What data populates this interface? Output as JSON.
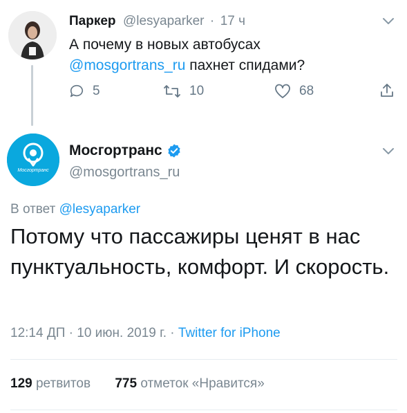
{
  "reply_tweet": {
    "author_name": "Паркер",
    "author_handle": "@lesyaparker",
    "separator": "·",
    "time": "17 ч",
    "text_line1": "А почему в новых автобусах",
    "mention": "@mosgortrans_ru",
    "text_line2_rest": " пахнет спидами?",
    "reply_count": "5",
    "retweet_count": "10",
    "like_count": "68"
  },
  "main_tweet": {
    "author_name": "Мосгортранс",
    "author_handle": "@mosgortrans_ru",
    "avatar_label": "Мосгортранс",
    "reply_prefix": "В ответ ",
    "reply_to": "@lesyaparker",
    "text": "Потому что пассажиры ценят в нас пунктуальность, комфорт. И скорость.",
    "time": "12:14 ДП",
    "date": "10 июн. 2019 г.",
    "sep1": " · ",
    "sep2": " · ",
    "source": "Twitter for iPhone",
    "retweets_count": "129",
    "retweets_label": "ретвитов",
    "likes_count": "775",
    "likes_label": "отметок «Нравится»"
  },
  "colors": {
    "accent": "#1d9bf0",
    "muted": "#7a8791",
    "avatar_brand": "#0aa8de"
  },
  "icons": [
    "chevron-down-icon",
    "reply-icon",
    "retweet-icon",
    "like-icon",
    "share-icon",
    "verified-badge-icon"
  ]
}
